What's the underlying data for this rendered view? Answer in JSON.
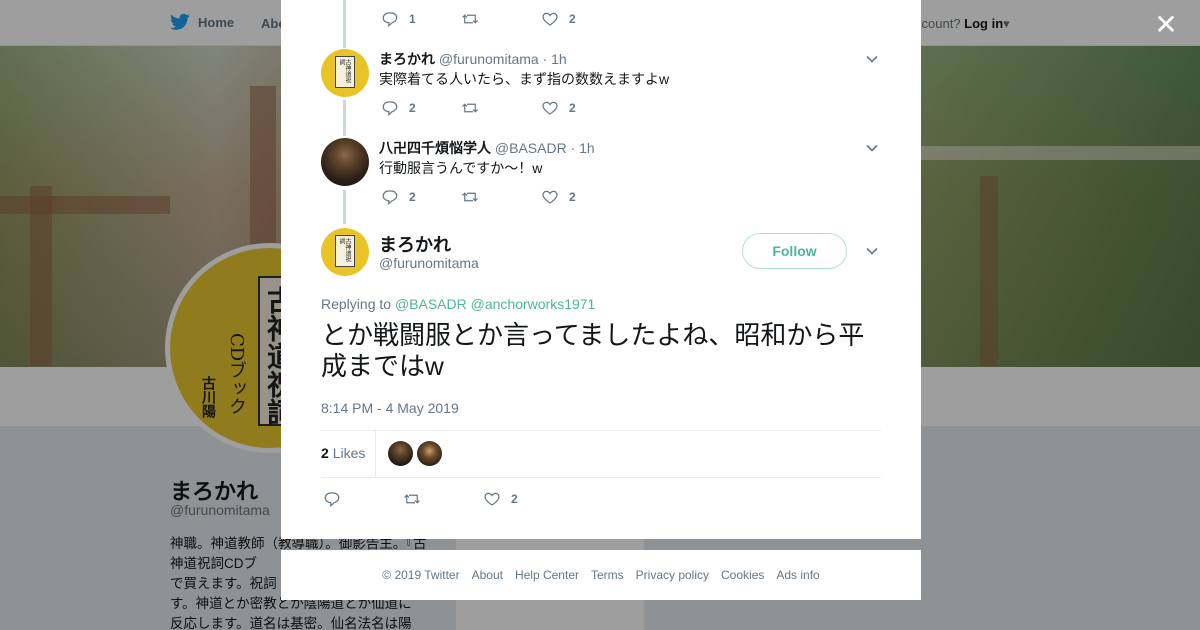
{
  "nav": {
    "home_label": "Home",
    "about_label": "Abo",
    "account_prompt": "ccount?",
    "login_label": "Log in"
  },
  "profile": {
    "avatar_text_main": "古神道祝詞",
    "avatar_text_sub": "CDブック",
    "avatar_text_author": "古川陽",
    "name": "まろかれ",
    "handle": "@furunomitama",
    "bio": "神職。神道教師（教導職）。御影告主。『古神道祝詞CDブ",
    "bio_line2": "で買えます。祝詞",
    "bio_line3": "す。神道とか密教とか陰陽道とか仙道に",
    "bio_line4": "反応します。道名は基密。仙名法名は陽"
  },
  "colors": {
    "accent": "#4fb59a",
    "twitter_blue": "#1da1f2",
    "muted": "#657786",
    "border": "#e6ecf0"
  },
  "thread": {
    "top_actions": {
      "replies": "1",
      "retweets": "",
      "likes": "2"
    },
    "replies": [
      {
        "name": "まろかれ",
        "handle": "@furunomitama",
        "time": "· 1h",
        "text": "実際着てる人いたら、まず指の数数えますよw",
        "replies": "2",
        "retweets": "",
        "likes": "2",
        "avatar": "book-avatar"
      },
      {
        "name": "八卍四千煩悩学人",
        "handle": "@BASADR",
        "time": "· 1h",
        "text": "行動服言うんですか〜！w",
        "replies": "2",
        "retweets": "",
        "likes": "2",
        "avatar": "person-avatar"
      }
    ]
  },
  "main_tweet": {
    "name": "まろかれ",
    "handle": "@furunomitama",
    "follow_label": "Follow",
    "replying_to_label": "Replying to",
    "replying_to_1": "@BASADR",
    "replying_to_2": "@anchorworks1971",
    "text": "とか戦闘服とか言ってましたよね、昭和から平成まではw",
    "timestamp": "8:14 PM - 4 May 2019",
    "likes_count": "2",
    "likes_label": "Likes",
    "replies": "",
    "retweets": "",
    "likes": "2"
  },
  "footer": {
    "copyright": "© 2019 Twitter",
    "about": "About",
    "help": "Help Center",
    "terms": "Terms",
    "privacy": "Privacy policy",
    "cookies": "Cookies",
    "ads": "Ads info"
  },
  "bg_box_text": "Ads info",
  "icons": {
    "close": "close-icon",
    "reply": "reply-icon",
    "retweet": "retweet-icon",
    "like": "heart-icon",
    "caret": "chevron-down-icon",
    "bird": "twitter-bird-icon"
  }
}
